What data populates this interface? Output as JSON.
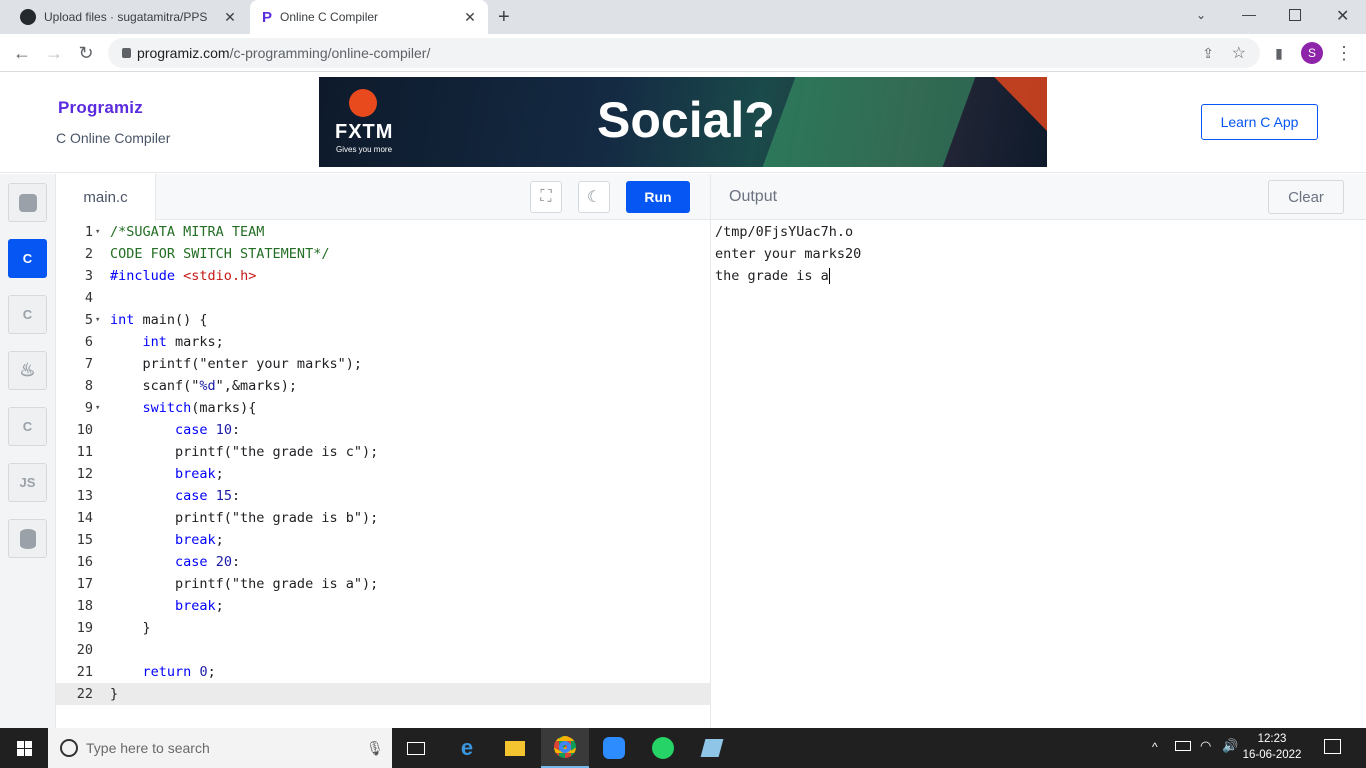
{
  "browser": {
    "tabs": [
      {
        "title": "Upload files · sugatamitra/PPS",
        "icon": "github-icon"
      },
      {
        "title": "Online C Compiler",
        "icon": "programiz-icon"
      }
    ],
    "url_host": "programiz.com",
    "url_path": "/c-programming/online-compiler/",
    "profile_initial": "S"
  },
  "header": {
    "logo": "Programiz",
    "subtitle": "C Online Compiler",
    "ad_brand": "FXTM",
    "ad_tagline": "Gives you more",
    "ad_headline": "Social?",
    "learn_button": "Learn C App"
  },
  "sidebar": {
    "items": [
      {
        "name": "python",
        "label": ""
      },
      {
        "name": "c",
        "label": "C"
      },
      {
        "name": "cpp",
        "label": "C"
      },
      {
        "name": "java",
        "label": "♨"
      },
      {
        "name": "csharp",
        "label": "C"
      },
      {
        "name": "js",
        "label": "JS"
      },
      {
        "name": "sql",
        "label": ""
      }
    ]
  },
  "editor": {
    "filename": "main.c",
    "run_label": "Run",
    "lines": [
      {
        "n": "1",
        "fold": true,
        "html": "<span class=\"c-cm\">/*SUGATA MITRA TEAM</span>"
      },
      {
        "n": "2",
        "fold": false,
        "html": "<span class=\"c-cm\">CODE FOR SWITCH STATEMENT*/</span>"
      },
      {
        "n": "3",
        "fold": false,
        "html": "<span class=\"c-inc\">#include</span> <span class=\"c-hdr\">&lt;stdio.h&gt;</span>"
      },
      {
        "n": "4",
        "fold": false,
        "html": ""
      },
      {
        "n": "5",
        "fold": true,
        "html": "<span class=\"c-kw\">int</span> main() {"
      },
      {
        "n": "6",
        "fold": false,
        "html": "    <span class=\"c-kw\">int</span> marks;"
      },
      {
        "n": "7",
        "fold": false,
        "html": "    printf(\"enter your marks\");"
      },
      {
        "n": "8",
        "fold": false,
        "html": "    scanf(\"<span class=\"c-str\">%d</span>\",&amp;marks);"
      },
      {
        "n": "9",
        "fold": true,
        "html": "    <span class=\"c-kw\">switch</span>(marks){"
      },
      {
        "n": "10",
        "fold": false,
        "html": "        <span class=\"c-kw\">case</span> <span class=\"c-num\">10</span>:"
      },
      {
        "n": "11",
        "fold": false,
        "html": "        printf(\"the grade is c\");"
      },
      {
        "n": "12",
        "fold": false,
        "html": "        <span class=\"c-kw\">break</span>;"
      },
      {
        "n": "13",
        "fold": false,
        "html": "        <span class=\"c-kw\">case</span> <span class=\"c-num\">15</span>:"
      },
      {
        "n": "14",
        "fold": false,
        "html": "        printf(\"the grade is b\");"
      },
      {
        "n": "15",
        "fold": false,
        "html": "        <span class=\"c-kw\">break</span>;"
      },
      {
        "n": "16",
        "fold": false,
        "html": "        <span class=\"c-kw\">case</span> <span class=\"c-num\">20</span>:"
      },
      {
        "n": "17",
        "fold": false,
        "html": "        printf(\"the grade is a\");"
      },
      {
        "n": "18",
        "fold": false,
        "html": "        <span class=\"c-kw\">break</span>;"
      },
      {
        "n": "19",
        "fold": false,
        "html": "    }"
      },
      {
        "n": "20",
        "fold": false,
        "html": ""
      },
      {
        "n": "21",
        "fold": false,
        "html": "    <span class=\"c-kw\">return</span> <span class=\"c-num\">0</span>;"
      },
      {
        "n": "22",
        "fold": false,
        "html": "}"
      }
    ],
    "active_line": 22
  },
  "output": {
    "label": "Output",
    "clear_label": "Clear",
    "lines": [
      "/tmp/0FjsYUac7h.o",
      "enter your marks20",
      "the grade is a"
    ]
  },
  "taskbar": {
    "search_placeholder": "Type here to search",
    "time": "12:23",
    "date": "16-06-2022"
  },
  "colors": {
    "accent": "#0556f3",
    "brand": "#5b2be0"
  }
}
